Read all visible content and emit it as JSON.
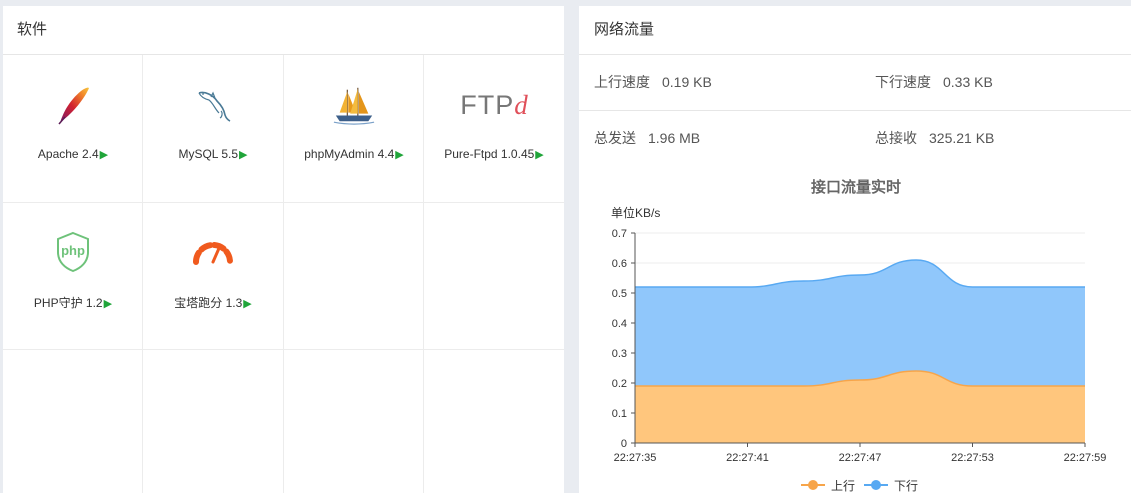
{
  "software": {
    "title": "软件",
    "items": [
      {
        "name": "Apache 2.4",
        "icon": "apache-feather-icon"
      },
      {
        "name": "MySQL 5.5",
        "icon": "mysql-dolphin-icon"
      },
      {
        "name": "phpMyAdmin 4.4",
        "icon": "phpmyadmin-ship-icon"
      },
      {
        "name": "Pure-Ftpd 1.0.45",
        "icon": "ftpd-logo-icon"
      },
      {
        "name": "PHP守护 1.2",
        "icon": "php-shield-icon"
      },
      {
        "name": "宝塔跑分 1.3",
        "icon": "speedometer-icon"
      }
    ],
    "play_glyph": "▶",
    "ftp_logo_text": "FTP",
    "ftp_logo_d": "d",
    "php_logo_text": "php"
  },
  "network": {
    "title": "网络流量",
    "up_speed_label": "上行速度",
    "up_speed_value": "0.19 KB",
    "down_speed_label": "下行速度",
    "down_speed_value": "0.33 KB",
    "total_sent_label": "总发送",
    "total_sent_value": "1.96 MB",
    "total_recv_label": "总接收",
    "total_recv_value": "325.21 KB"
  },
  "chart_data": {
    "type": "area",
    "title": "接口流量实时",
    "ylabel": "单位KB/s",
    "ylim": [
      0,
      0.7
    ],
    "yticks": [
      "0",
      "0.1",
      "0.2",
      "0.3",
      "0.4",
      "0.5",
      "0.6",
      "0.7"
    ],
    "x": [
      "22:27:35",
      "22:27:38",
      "22:27:41",
      "22:27:44",
      "22:27:47",
      "22:27:50",
      "22:27:53",
      "22:27:56",
      "22:27:59"
    ],
    "xticks": [
      "22:27:35",
      "22:27:41",
      "22:27:47",
      "22:27:53",
      "22:27:59"
    ],
    "stacked": true,
    "series": [
      {
        "name": "上行",
        "values": [
          0.19,
          0.19,
          0.19,
          0.19,
          0.21,
          0.24,
          0.19,
          0.19,
          0.19
        ],
        "color": "#f7a54a",
        "fill": "#ffc67d"
      },
      {
        "name": "下行",
        "values": [
          0.33,
          0.33,
          0.33,
          0.35,
          0.35,
          0.37,
          0.33,
          0.33,
          0.33
        ],
        "color": "#58a9f2",
        "fill": "#90c7fb"
      }
    ],
    "legend_position": "bottom-center",
    "grid": true
  }
}
